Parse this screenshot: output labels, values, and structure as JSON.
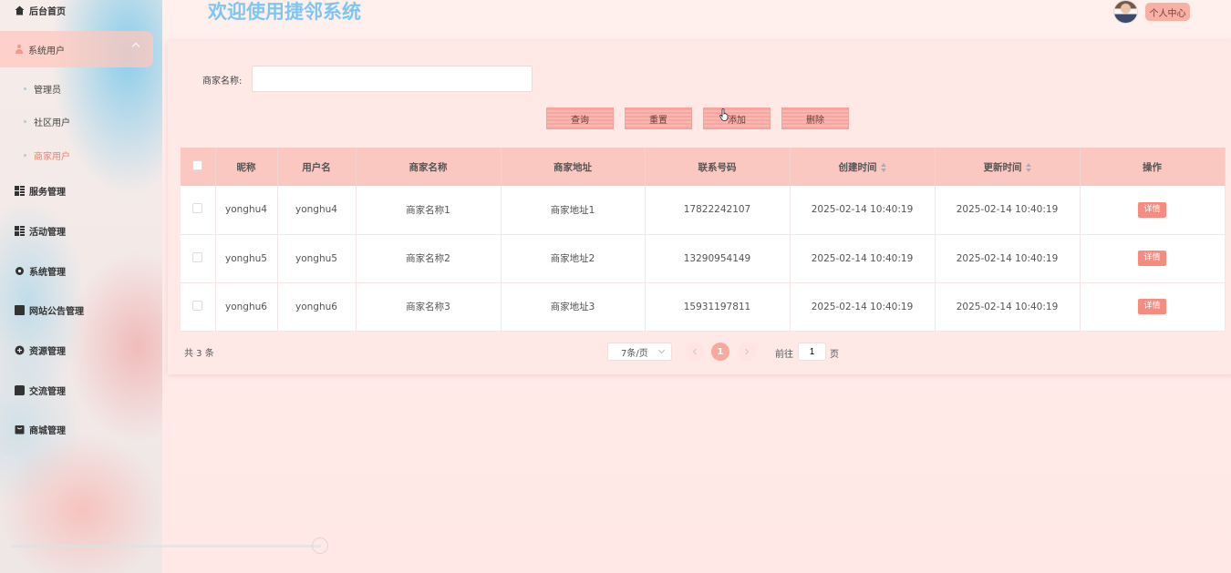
{
  "header": {
    "title": "欢迎使用捷邻系统",
    "profile_button": "个人中心"
  },
  "sidebar": {
    "items": [
      {
        "label": "后台首页",
        "icon": "home-icon"
      },
      {
        "label": "系统用户",
        "icon": "user-icon",
        "expanded": true
      },
      {
        "label": "服务管理",
        "icon": "grid-icon"
      },
      {
        "label": "活动管理",
        "icon": "grid-icon"
      },
      {
        "label": "系统管理",
        "icon": "gear-icon"
      },
      {
        "label": "网站公告管理",
        "icon": "document-icon"
      },
      {
        "label": "资源管理",
        "icon": "plus-circle-icon"
      },
      {
        "label": "交流管理",
        "icon": "chat-icon"
      },
      {
        "label": "商城管理",
        "icon": "shop-icon"
      }
    ],
    "sub_items": [
      {
        "label": "管理员",
        "active": false
      },
      {
        "label": "社区用户",
        "active": false
      },
      {
        "label": "商家用户",
        "active": true
      }
    ]
  },
  "search": {
    "label": "商家名称:",
    "value": "",
    "placeholder": ""
  },
  "buttons": {
    "query": "查询",
    "reset": "重置",
    "add": "添加",
    "delete": "删除"
  },
  "table": {
    "columns": [
      "昵称",
      "用户名",
      "商家名称",
      "商家地址",
      "联系号码",
      "创建时间",
      "更新时间",
      "操作"
    ],
    "rows": [
      {
        "nickname": "yonghu4",
        "username": "yonghu4",
        "shop_name": "商家名称1",
        "shop_address": "商家地址1",
        "phone": "17822242107",
        "created": "2025-02-14 10:40:19",
        "updated": "2025-02-14 10:40:19",
        "action": "详情"
      },
      {
        "nickname": "yonghu5",
        "username": "yonghu5",
        "shop_name": "商家名称2",
        "shop_address": "商家地址2",
        "phone": "13290954149",
        "created": "2025-02-14 10:40:19",
        "updated": "2025-02-14 10:40:19",
        "action": "详情"
      },
      {
        "nickname": "yonghu6",
        "username": "yonghu6",
        "shop_name": "商家名称3",
        "shop_address": "商家地址3",
        "phone": "15931197811",
        "created": "2025-02-14 10:40:19",
        "updated": "2025-02-14 10:40:19",
        "action": "详情"
      }
    ]
  },
  "pagination": {
    "total_text": "共 3 条",
    "page_size": "7条/页",
    "current_page": "1",
    "goto_prefix": "前往",
    "goto_value": "1",
    "goto_suffix": "页"
  },
  "colors": {
    "title": "#7fc6ee",
    "accent": "#f58c7f",
    "header_row": "#fbc8c1"
  }
}
